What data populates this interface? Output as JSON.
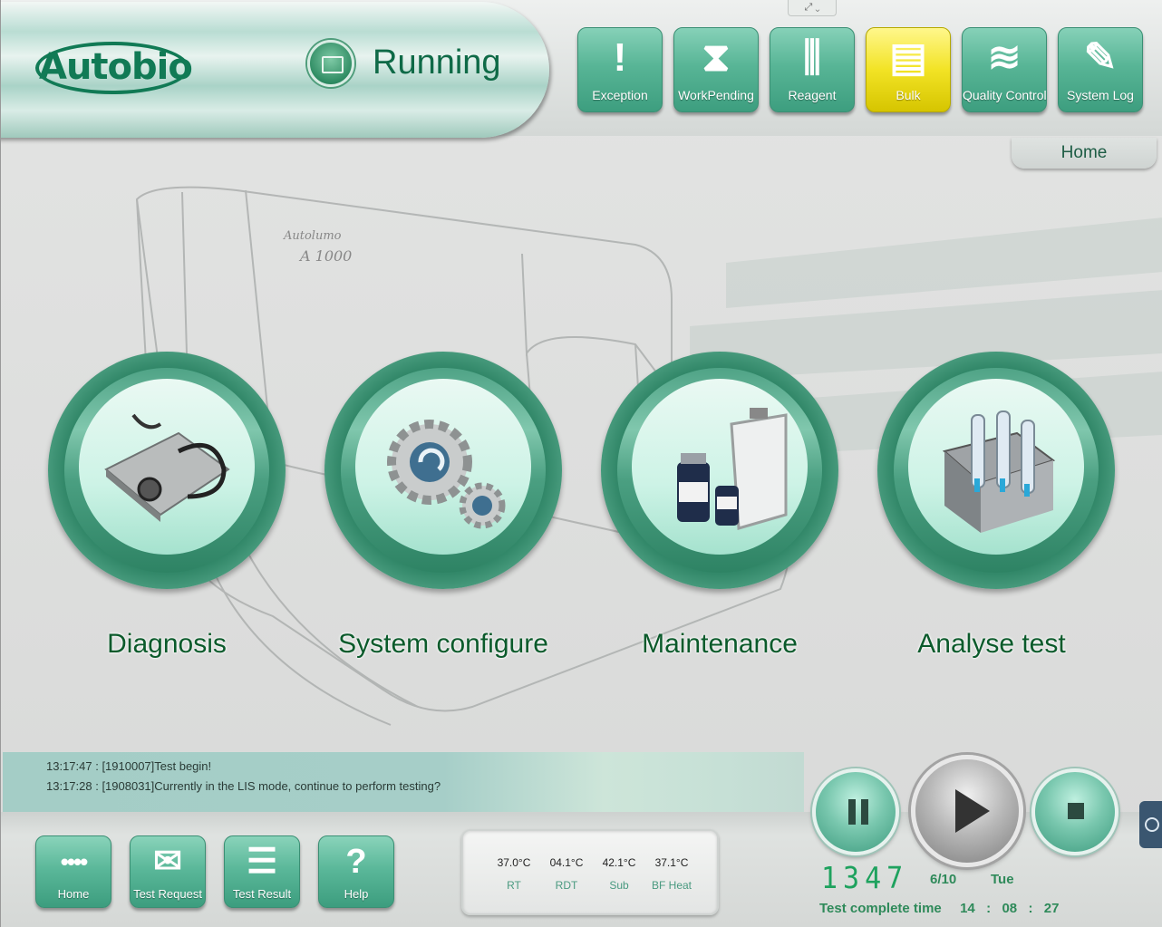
{
  "header": {
    "logo_text": "Autobio",
    "status": "Running",
    "toolbar": [
      {
        "label": "Exception",
        "icon": "exclamation-icon",
        "glyph": "!",
        "active": false
      },
      {
        "label": "WorkPending",
        "icon": "hourglass-icon",
        "glyph": "⧗",
        "active": false
      },
      {
        "label": "Reagent",
        "icon": "reagent-rack-icon",
        "glyph": "⫼",
        "active": false
      },
      {
        "label": "Bulk",
        "icon": "bulk-bottles-icon",
        "glyph": "▤",
        "active": true
      },
      {
        "label": "Quality Control",
        "icon": "qc-chart-icon",
        "glyph": "≋",
        "active": false
      },
      {
        "label": "System Log",
        "icon": "log-document-icon",
        "glyph": "✎",
        "active": false
      }
    ],
    "breadcrumb": "Home"
  },
  "functions": [
    {
      "label": "Diagnosis",
      "icon": "stethoscope-icon"
    },
    {
      "label": "System configure",
      "icon": "gears-icon"
    },
    {
      "label": "Maintenance",
      "icon": "clipboard-bottles-icon"
    },
    {
      "label": "Analyse test",
      "icon": "test-tube-rack-icon"
    }
  ],
  "log": [
    "13:17:47 : [1910007]Test begin!",
    "13:17:28 : [1908031]Currently in the LIS mode, continue to perform testing?"
  ],
  "nav": [
    {
      "label": "Home",
      "icon": "home-dots-icon",
      "glyph": "••••"
    },
    {
      "label": "Test Request",
      "icon": "envelope-request-icon",
      "glyph": "✉"
    },
    {
      "label": "Test Result",
      "icon": "result-document-icon",
      "glyph": "☰"
    },
    {
      "label": "Help",
      "icon": "question-icon",
      "glyph": "?"
    }
  ],
  "temperatures": [
    {
      "value": "37.0°C",
      "name": "RT"
    },
    {
      "value": "04.1°C",
      "name": "RDT"
    },
    {
      "value": "42.1°C",
      "name": "Sub"
    },
    {
      "value": "37.1°C",
      "name": "BF Heat"
    }
  ],
  "status_panel": {
    "counter": "1347",
    "date": "6/10",
    "day": "Tue",
    "complete_label": "Test complete time",
    "hh": "14",
    "mm": "08",
    "ss": "27",
    "sep": ":"
  },
  "colors": {
    "accent": "#3d9e7f",
    "active_button": "#f2e325",
    "label_green": "#0b5a2b"
  }
}
